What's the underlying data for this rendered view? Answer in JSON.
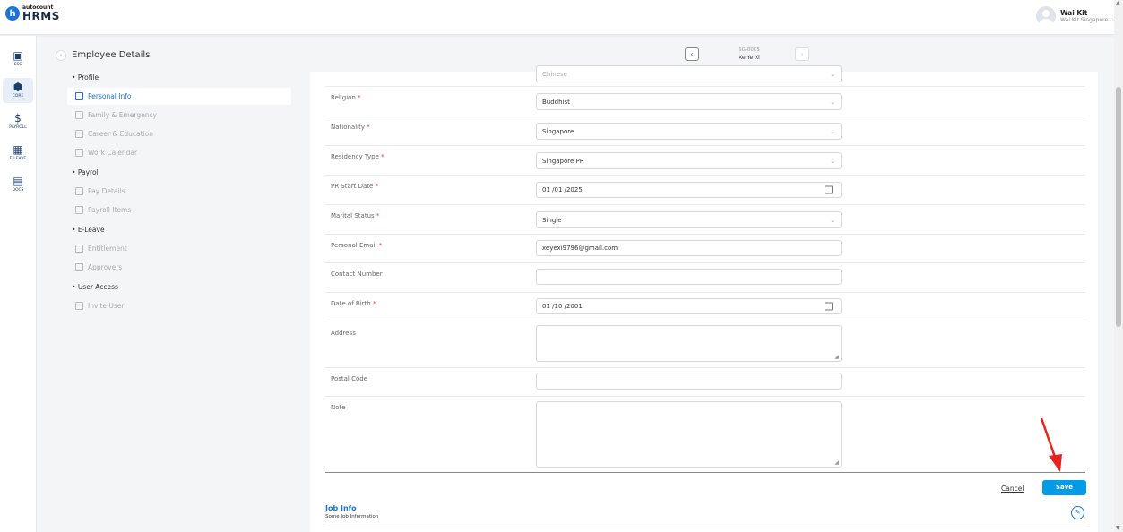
{
  "app": {
    "logo_letter": "h",
    "brand_sub": "autocount",
    "brand_main": "HRMS"
  },
  "user": {
    "name": "Wai Kit",
    "org": "Wai Kit Singapore ⌄"
  },
  "left_nav": [
    {
      "label": "ESS",
      "icon": "id-card-icon"
    },
    {
      "label": "CORE",
      "icon": "cube-icon"
    },
    {
      "label": "PAYROLL",
      "icon": "dollar-icon"
    },
    {
      "label": "E-LEAVE",
      "icon": "calendar-icon"
    },
    {
      "label": "DOCS",
      "icon": "document-icon"
    }
  ],
  "page": {
    "title": "Employee Details",
    "emp_code": "SG-0005",
    "emp_name": "Xe Ye Xi"
  },
  "side_menu": {
    "sections": [
      "Profile",
      "Payroll",
      "E-Leave",
      "User Access"
    ],
    "items": [
      "Personal Info",
      "Family & Emergency",
      "Career & Education",
      "Work Calendar",
      "Pay Details",
      "Payroll Items",
      "Entitlement",
      "Approvers",
      "Invite User"
    ]
  },
  "form": {
    "partial_value": "Chinese",
    "religion": {
      "label": "Religion",
      "value": "Buddhist"
    },
    "nationality": {
      "label": "Nationality",
      "value": "Singapore"
    },
    "residency": {
      "label": "Residency Type",
      "value": "Singapore PR"
    },
    "pr_start": {
      "label": "PR Start Date",
      "value": "01 /01 /2025"
    },
    "marital": {
      "label": "Marital Status",
      "value": "Single"
    },
    "email": {
      "label": "Personal Email",
      "value": "xeyexi9796@gmail.com"
    },
    "contact": {
      "label": "Contact Number",
      "value": ""
    },
    "dob": {
      "label": "Date of Birth",
      "value": "01 /10 /2001"
    },
    "address": {
      "label": "Address",
      "value": ""
    },
    "postal": {
      "label": "Postal Code",
      "value": ""
    },
    "note": {
      "label": "Note",
      "value": ""
    }
  },
  "actions": {
    "cancel": "Cancel",
    "save": "Save"
  },
  "job": {
    "title": "Job Info",
    "subtitle": "Some Job Information"
  },
  "colors": {
    "accent": "#1a73d9",
    "save": "#039be5",
    "required": "#e53935",
    "arrow": "#e8231d"
  }
}
